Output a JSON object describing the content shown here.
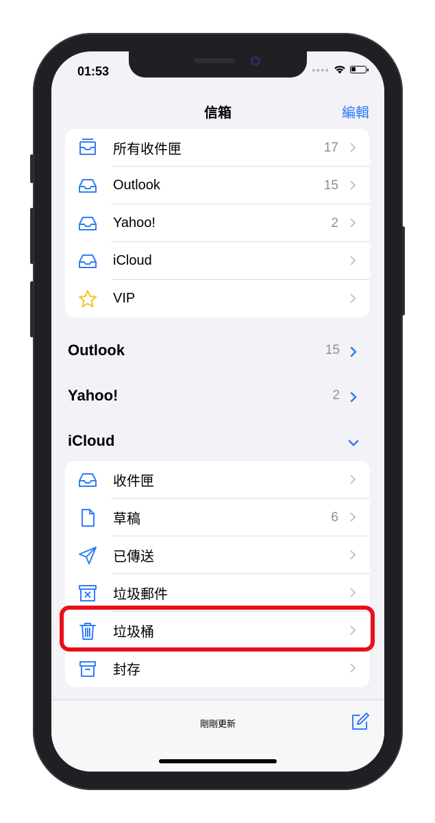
{
  "status": {
    "time": "01:53"
  },
  "nav": {
    "title": "信箱",
    "edit": "編輯"
  },
  "mailboxes": [
    {
      "label": "所有收件匣",
      "count": "17",
      "icon": "all-inboxes-icon"
    },
    {
      "label": "Outlook",
      "count": "15",
      "icon": "inbox-tray-icon"
    },
    {
      "label": "Yahoo!",
      "count": "2",
      "icon": "inbox-tray-icon"
    },
    {
      "label": "iCloud",
      "count": "",
      "icon": "inbox-tray-icon"
    },
    {
      "label": "VIP",
      "count": "",
      "icon": "star-icon"
    }
  ],
  "accounts": [
    {
      "name": "Outlook",
      "count": "15"
    },
    {
      "name": "Yahoo!",
      "count": "2"
    },
    {
      "name": "iCloud",
      "count": ""
    }
  ],
  "icloud_folders": [
    {
      "label": "收件匣",
      "count": "",
      "icon": "inbox-tray-icon"
    },
    {
      "label": "草稿",
      "count": "6",
      "icon": "document-icon"
    },
    {
      "label": "已傳送",
      "count": "",
      "icon": "paper-plane-icon"
    },
    {
      "label": "垃圾郵件",
      "count": "",
      "icon": "junk-box-icon"
    },
    {
      "label": "垃圾桶",
      "count": "",
      "icon": "trash-icon"
    },
    {
      "label": "封存",
      "count": "",
      "icon": "archive-box-icon"
    }
  ],
  "toolbar": {
    "status": "剛剛更新"
  },
  "colors": {
    "accent": "#2f7cf6",
    "highlight": "#e8101a",
    "star": "#f5c518",
    "background": "#f2f2f7"
  }
}
